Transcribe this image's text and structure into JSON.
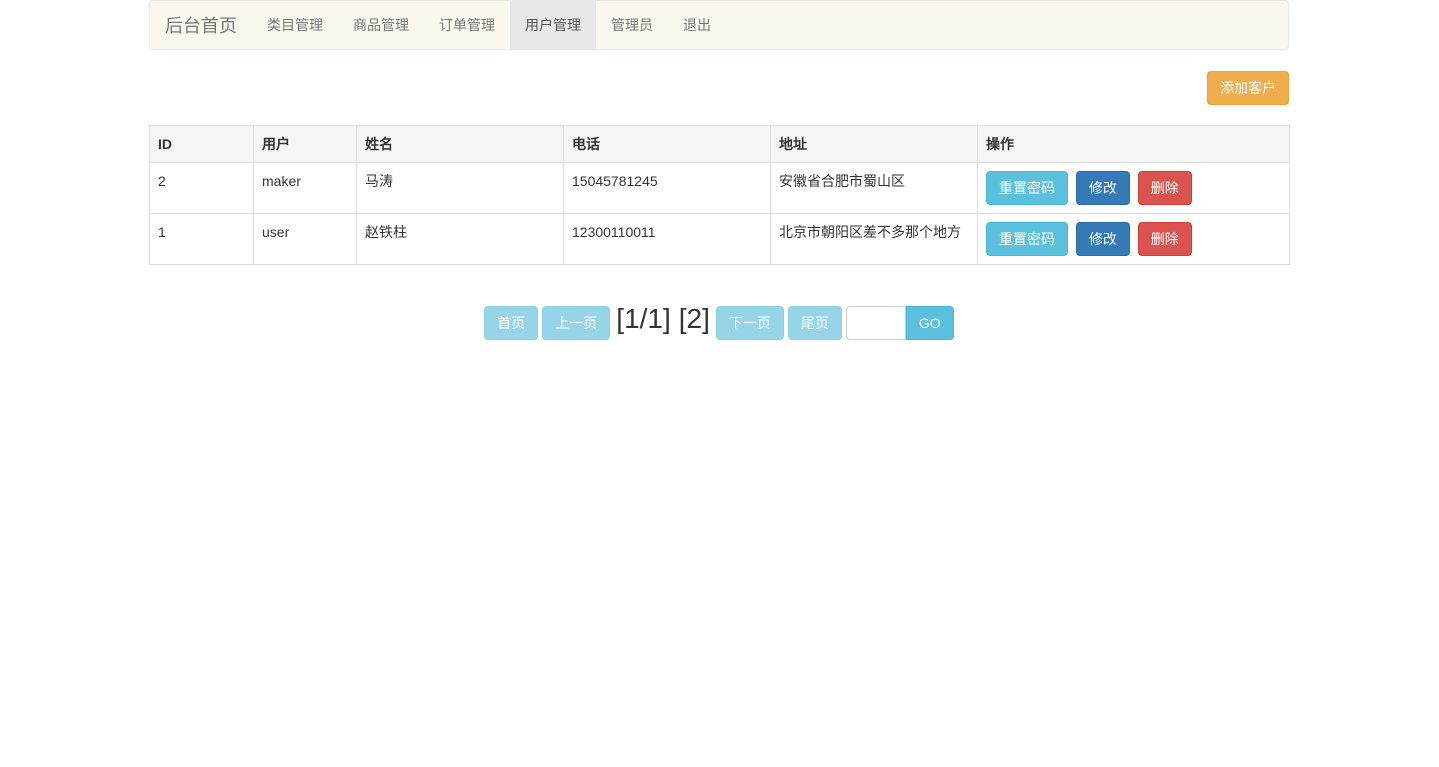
{
  "navbar": {
    "brand": "后台首页",
    "items": [
      {
        "label": "类目管理",
        "active": false
      },
      {
        "label": "商品管理",
        "active": false
      },
      {
        "label": "订单管理",
        "active": false
      },
      {
        "label": "用户管理",
        "active": true
      },
      {
        "label": "管理员",
        "active": false
      },
      {
        "label": "退出",
        "active": false
      }
    ]
  },
  "toolbar": {
    "add_label": "添加客户"
  },
  "table": {
    "headers": [
      "ID",
      "用户",
      "姓名",
      "电话",
      "地址",
      "操作"
    ],
    "rows": [
      {
        "id": "2",
        "user": "maker",
        "name": "马涛",
        "phone": "15045781245",
        "address": "安徽省合肥市蜀山区"
      },
      {
        "id": "1",
        "user": "user",
        "name": "赵铁柱",
        "phone": "12300110011",
        "address": "北京市朝阳区差不多那个地方"
      }
    ],
    "actions": {
      "reset": "重置密码",
      "edit": "修改",
      "delete": "删除"
    }
  },
  "pager": {
    "first": "首页",
    "prev": "上一页",
    "current": "[1/1]",
    "page_link": "[2]",
    "next": "下一页",
    "last": "尾页",
    "input_value": "",
    "go": "GO"
  },
  "colors": {
    "warning": "#f0ad4e",
    "info": "#5bc0de",
    "primary": "#337ab7",
    "danger": "#d9534f",
    "navbar_bg": "#faf7ef"
  }
}
